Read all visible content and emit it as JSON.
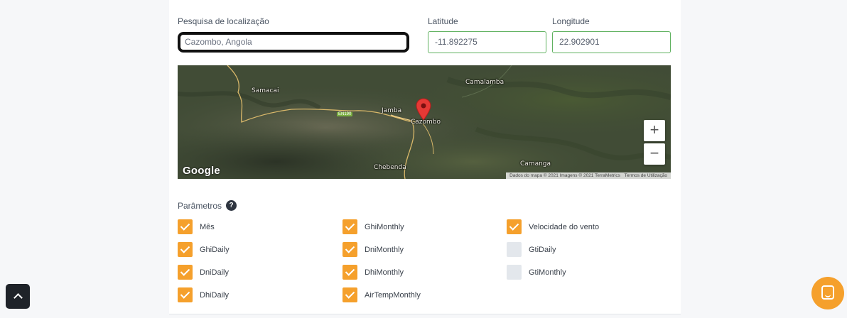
{
  "form": {
    "search_label": "Pesquisa de localização",
    "search_value": "Cazombo, Angola",
    "latitude_label": "Latitude",
    "latitude_value": "-11.892275",
    "longitude_label": "Longitude",
    "longitude_value": "22.902901"
  },
  "map": {
    "places": {
      "samacai": "Samacai",
      "camalamba": "Camalamba",
      "jamba": "Jamba",
      "cazombo": "Cazombo",
      "chebenda": "Chebenda",
      "camanga": "Camanga"
    },
    "road_label": "EN190",
    "zoom_in": "+",
    "zoom_out": "−",
    "logo": "Google",
    "attribution": "Dados do mapa © 2021 Imagens © 2021 TerraMetrics",
    "terms": "Termos de Utilização",
    "marker_icon": "map-pin-icon"
  },
  "params": {
    "title": "Parâmetros",
    "help_icon": "?",
    "items": [
      {
        "label": "Mês",
        "checked": true
      },
      {
        "label": "GhiDaily",
        "checked": true
      },
      {
        "label": "DniDaily",
        "checked": true
      },
      {
        "label": "DhiDaily",
        "checked": true
      },
      {
        "label": "GhiMonthly",
        "checked": true
      },
      {
        "label": "DniMonthly",
        "checked": true
      },
      {
        "label": "DhiMonthly",
        "checked": true
      },
      {
        "label": "AirTempMonthly",
        "checked": true
      },
      {
        "label": "Velocidade do vento",
        "checked": true
      },
      {
        "label": "GtiDaily",
        "checked": false
      },
      {
        "label": "GtiMonthly",
        "checked": false
      }
    ]
  },
  "colors": {
    "accent": "#f5a02c",
    "valid_border": "#5fb15f",
    "unchecked": "#e3e7ec"
  },
  "widgets": {
    "scroll_top_icon": "chevron-up-icon",
    "chat_icon": "chat-icon"
  }
}
